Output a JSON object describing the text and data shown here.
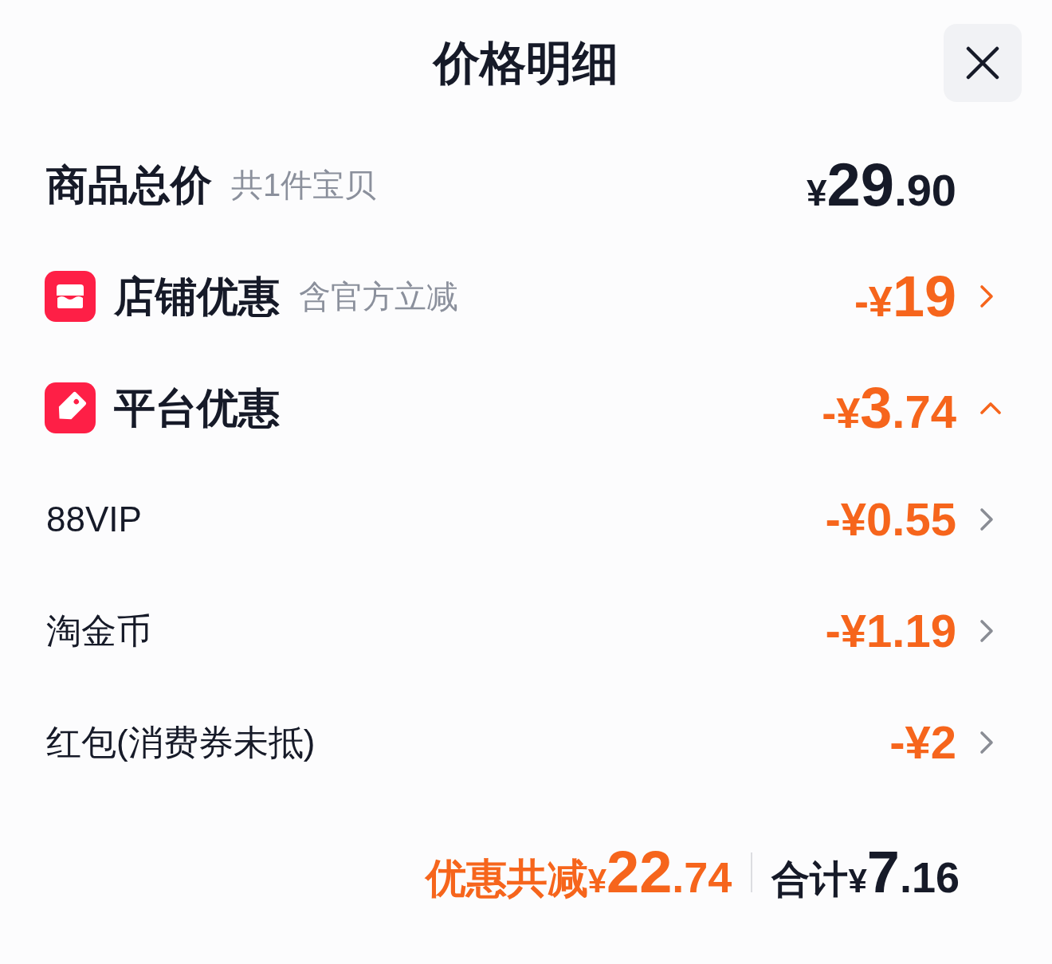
{
  "header": {
    "title": "价格明细"
  },
  "subtotal": {
    "label": "商品总价",
    "note": "共1件宝贝",
    "price": {
      "prefix": "¥",
      "major": "29",
      "minor": ".90"
    }
  },
  "discounts": [
    {
      "kind": "store",
      "label": "店铺优惠",
      "note": "含官方立减",
      "amount": {
        "prefix": "-¥",
        "major": "19"
      },
      "expanded": false
    },
    {
      "kind": "platform",
      "label": "平台优惠",
      "amount": {
        "prefix": "-¥",
        "major": "3",
        "minor": ".74"
      },
      "expanded": true,
      "children": [
        {
          "label": "88VIP",
          "amount": "-¥0.55"
        },
        {
          "label": "淘金币",
          "amount": "-¥1.19"
        },
        {
          "label": "红包(消费券未抵)",
          "amount": "-¥2"
        }
      ]
    }
  ],
  "footer": {
    "saved": {
      "label": "优惠共减",
      "prefix": "¥",
      "major": "22",
      "minor": ".74"
    },
    "total": {
      "label": "合计",
      "prefix": "¥",
      "major": "7",
      "minor": ".16"
    }
  }
}
